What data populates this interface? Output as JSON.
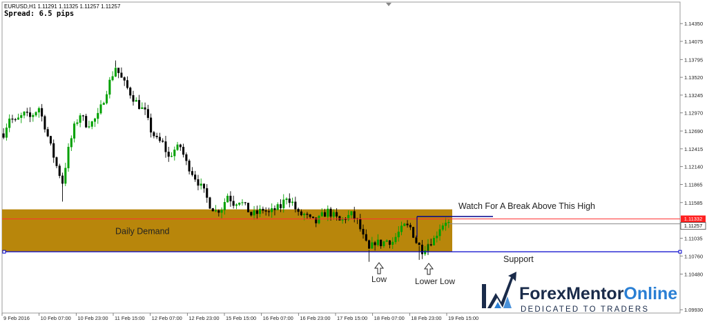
{
  "chart_window": {
    "header": "EURUSD,H1  1.11291 1.11325 1.11257 1.11257",
    "spread": "Spread: 6.5 pips"
  },
  "chart_data": {
    "type": "candlestick",
    "symbol": "EURUSD",
    "timeframe": "H1",
    "ohlc_header": {
      "open": 1.11291,
      "high": 1.11325,
      "low": 1.11257,
      "close": 1.11257
    },
    "ylim": [
      1.099,
      1.1465
    ],
    "y_ticks": [
      "1.14350",
      "1.14075",
      "1.13795",
      "1.13520",
      "1.13245",
      "1.12970",
      "1.12690",
      "1.12415",
      "1.12140",
      "1.11865",
      "1.11585",
      "1.11035",
      "1.10760",
      "1.10480",
      "1.09930"
    ],
    "x_ticks": [
      "9 Feb 2016",
      "10 Feb 07:00",
      "10 Feb 23:00",
      "11 Feb 15:00",
      "12 Feb 07:00",
      "12 Feb 23:00",
      "15 Feb 15:00",
      "16 Feb 07:00",
      "16 Feb 23:00",
      "17 Feb 15:00",
      "18 Feb 07:00",
      "18 Feb 23:00",
      "19 Feb 15:00"
    ],
    "price_labels": {
      "bid_line": "1.11332",
      "close": "1.11257"
    },
    "price_lines": {
      "red_line": 1.11332,
      "gray_line": 1.11257,
      "support": 1.10825,
      "watch_high": 1.1137
    },
    "zone": {
      "label": "Daily Demand",
      "from": 1.10825,
      "to": 1.1148,
      "color": "#b8860b"
    },
    "path": [
      [
        0,
        1.1265
      ],
      [
        2,
        1.129
      ],
      [
        4,
        1.1283
      ],
      [
        7,
        1.1295
      ],
      [
        9,
        1.129
      ],
      [
        12,
        1.1305
      ],
      [
        14,
        1.1277
      ],
      [
        16,
        1.1245
      ],
      [
        18,
        1.1215
      ],
      [
        20,
        1.119
      ],
      [
        22,
        1.124
      ],
      [
        24,
        1.1275
      ],
      [
        26,
        1.1295
      ],
      [
        28,
        1.128
      ],
      [
        30,
        1.1282
      ],
      [
        32,
        1.1292
      ],
      [
        34,
        1.1318
      ],
      [
        36,
        1.1345
      ],
      [
        38,
        1.1368
      ],
      [
        40,
        1.135
      ],
      [
        42,
        1.1335
      ],
      [
        44,
        1.132
      ],
      [
        46,
        1.1308
      ],
      [
        48,
        1.1298
      ],
      [
        50,
        1.127
      ],
      [
        52,
        1.1255
      ],
      [
        54,
        1.125
      ],
      [
        56,
        1.1228
      ],
      [
        58,
        1.124
      ],
      [
        60,
        1.1245
      ],
      [
        62,
        1.122
      ],
      [
        64,
        1.1205
      ],
      [
        66,
        1.119
      ],
      [
        68,
        1.1175
      ],
      [
        70,
        1.1155
      ],
      [
        72,
        1.1145
      ],
      [
        74,
        1.115
      ],
      [
        76,
        1.117
      ],
      [
        78,
        1.1158
      ],
      [
        80,
        1.1162
      ],
      [
        82,
        1.1152
      ],
      [
        84,
        1.114
      ],
      [
        86,
        1.1142
      ],
      [
        88,
        1.1148
      ],
      [
        90,
        1.1142
      ],
      [
        92,
        1.1148
      ],
      [
        94,
        1.1152
      ],
      [
        96,
        1.1168
      ],
      [
        98,
        1.1158
      ],
      [
        100,
        1.114
      ],
      [
        102,
        1.114
      ],
      [
        104,
        1.1132
      ],
      [
        106,
        1.1128
      ],
      [
        108,
        1.1138
      ],
      [
        110,
        1.1145
      ],
      [
        112,
        1.1138
      ],
      [
        114,
        1.113
      ],
      [
        116,
        1.1135
      ],
      [
        118,
        1.114
      ],
      [
        120,
        1.113
      ],
      [
        122,
        1.1105
      ],
      [
        124,
        1.1085
      ],
      [
        126,
        1.1098
      ],
      [
        128,
        1.1095
      ],
      [
        130,
        1.11
      ],
      [
        132,
        1.1098
      ],
      [
        134,
        1.1112
      ],
      [
        136,
        1.1122
      ],
      [
        138,
        1.112
      ],
      [
        140,
        1.1098
      ],
      [
        142,
        1.1085
      ],
      [
        144,
        1.1095
      ],
      [
        146,
        1.1102
      ],
      [
        148,
        1.112
      ],
      [
        150,
        1.113
      ],
      [
        151,
        1.1126
      ]
    ],
    "candle_count": 152,
    "x_range": [
      3,
      652
    ],
    "grid": false,
    "colors": {
      "bull": "#00a000",
      "bear": "#000000",
      "zone": "#b8860b",
      "support": "#0000cc",
      "bid": "#ff2020"
    }
  },
  "annotations": {
    "watch": "Watch For A Break Above This High",
    "support": "Support",
    "low": "Low",
    "lower_low": "Lower Low",
    "arrow_icon": "up-arrow-icon"
  },
  "logo": {
    "word1": "Forex",
    "word2": "Mentor",
    "word3": "Online",
    "tagline": "DEDICATED TO TRADERS",
    "icon": "chart-up-arrow-icon",
    "colors": {
      "dark": "#1a2b4a",
      "blue": "#2a7fd4"
    }
  }
}
